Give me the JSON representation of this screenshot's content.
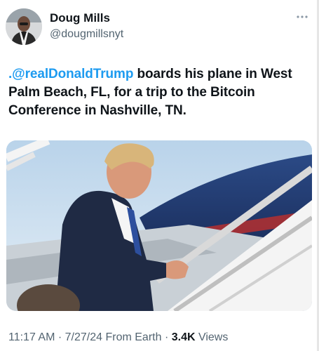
{
  "author": {
    "display_name": "Doug Mills",
    "handle": "@dougmillsnyt"
  },
  "tweet": {
    "mention": ".@realDonaldTrump",
    "text": " boards his plane in West Palm Beach, FL, for a trip to the Bitcoin Conference in Nashville, TN."
  },
  "meta": {
    "time": "11:17 AM",
    "separator": " · ",
    "date": "7/27/24",
    "source": "From Earth",
    "separator2": " · ",
    "views_count": "3.4K",
    "views_label": "Views"
  },
  "icons": {
    "more": "more-horizontal-icon"
  },
  "colors": {
    "link": "#1d9bf0",
    "text": "#0f1419",
    "secondary": "#536471"
  }
}
